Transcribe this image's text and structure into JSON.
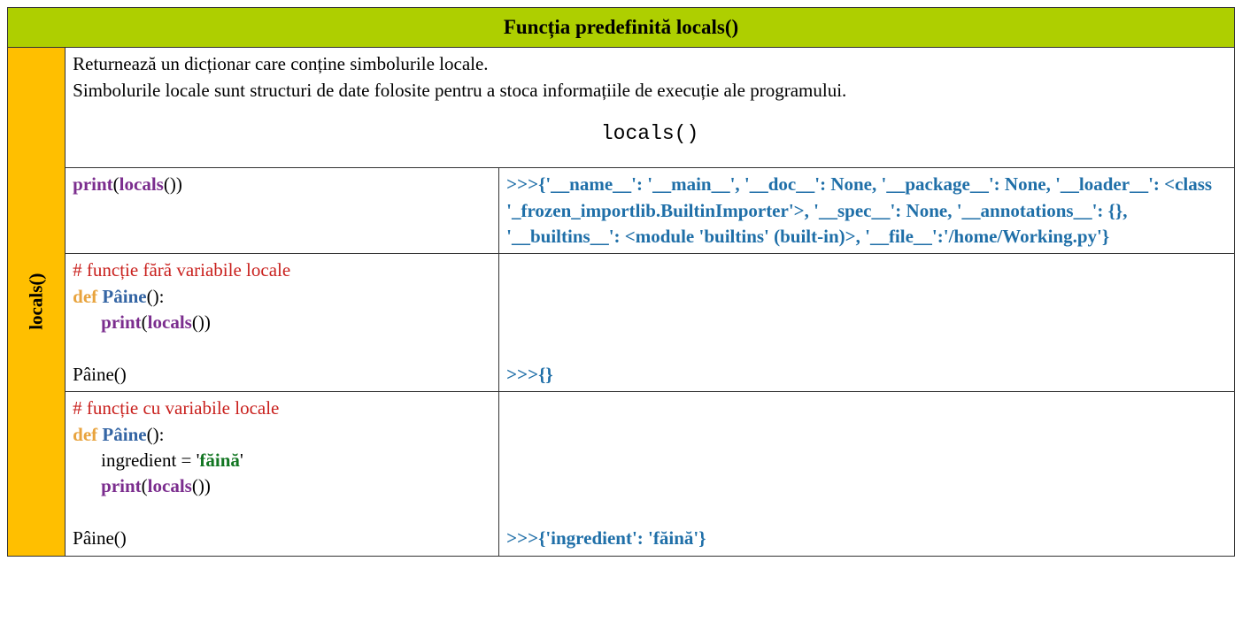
{
  "header": {
    "title": "Funcția predefinită locals()"
  },
  "side_label": "locals()",
  "description": {
    "line1": "Returnează un dicționar care conține simbolurile locale.",
    "line2": "Simbolurile locale sunt structuri de date folosite pentru a stoca informațiile de execuție ale programului.",
    "signature": "locals()"
  },
  "rows": [
    {
      "code": {
        "tokens": [
          {
            "t": "print",
            "cls": "c-fn"
          },
          {
            "t": "(",
            "cls": "c-paren"
          },
          {
            "t": "locals",
            "cls": "c-fn"
          },
          {
            "t": "())",
            "cls": "c-paren"
          }
        ]
      },
      "output": {
        "prompt": ">>>",
        "text": "{'__name__': '__main__', '__doc__': None, '__package__': None, '__loader__': <class '_frozen_importlib.BuiltinImporter'>, '__spec__': None, '__annotations__': {}, '__builtins__': <module 'builtins' (built-in)>, '__file__':'/home/Working.py'}"
      }
    },
    {
      "code": {
        "lines": [
          {
            "tokens": [
              {
                "t": "# funcție fără variabile locale",
                "cls": "c-comment"
              }
            ]
          },
          {
            "tokens": [
              {
                "t": "def ",
                "cls": "c-def"
              },
              {
                "t": "Pâine",
                "cls": "c-name"
              },
              {
                "t": "():",
                "cls": "c-paren"
              }
            ]
          },
          {
            "indent": 1,
            "tokens": [
              {
                "t": "print",
                "cls": "c-fn"
              },
              {
                "t": "(",
                "cls": "c-paren"
              },
              {
                "t": "locals",
                "cls": "c-fn"
              },
              {
                "t": "())",
                "cls": "c-paren"
              }
            ]
          },
          {
            "blank": true
          },
          {
            "tokens": [
              {
                "t": "Pâine()",
                "cls": "c-paren"
              }
            ]
          }
        ]
      },
      "output": {
        "prompt": ">>>",
        "text": "{}"
      }
    },
    {
      "code": {
        "lines": [
          {
            "tokens": [
              {
                "t": "# funcție cu variabile locale",
                "cls": "c-comment"
              }
            ]
          },
          {
            "tokens": [
              {
                "t": "def ",
                "cls": "c-def"
              },
              {
                "t": "Pâine",
                "cls": "c-name"
              },
              {
                "t": "():",
                "cls": "c-paren"
              }
            ]
          },
          {
            "indent": 1,
            "tokens": [
              {
                "t": "ingredient = '",
                "cls": "c-paren"
              },
              {
                "t": "făină",
                "cls": "c-str"
              },
              {
                "t": "'",
                "cls": "c-paren"
              }
            ]
          },
          {
            "indent": 1,
            "tokens": [
              {
                "t": "print",
                "cls": "c-fn"
              },
              {
                "t": "(",
                "cls": "c-paren"
              },
              {
                "t": "locals",
                "cls": "c-fn"
              },
              {
                "t": "())",
                "cls": "c-paren"
              }
            ]
          },
          {
            "blank": true
          },
          {
            "tokens": [
              {
                "t": "Pâine()",
                "cls": "c-paren"
              }
            ]
          }
        ]
      },
      "output": {
        "prompt": ">>>",
        "text": "{'ingredient': 'făină'}"
      }
    }
  ]
}
